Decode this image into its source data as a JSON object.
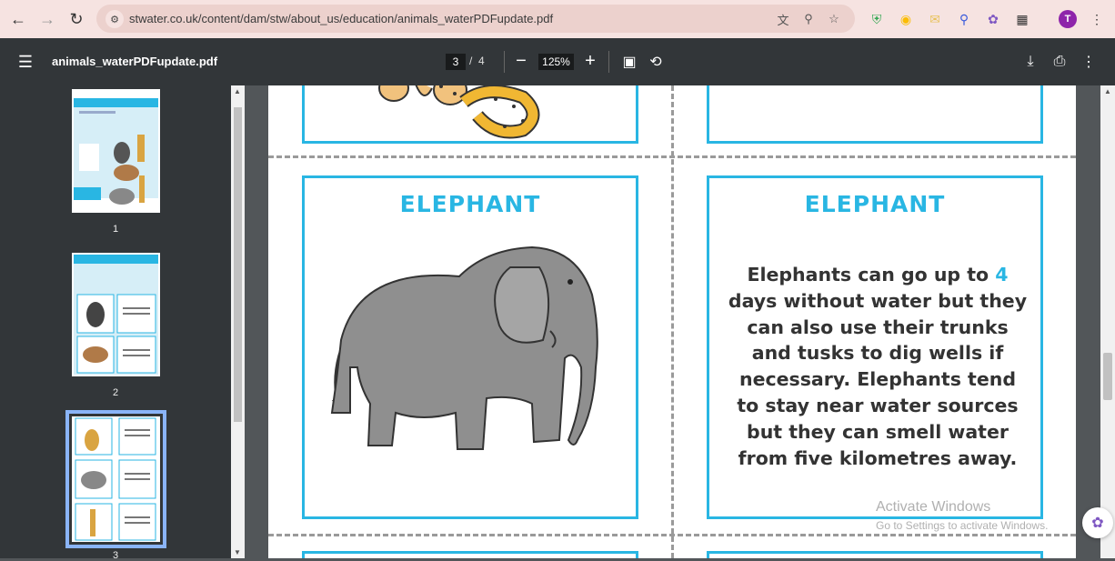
{
  "browser": {
    "url": "stwater.co.uk/content/dam/stw/about_us/education/animals_waterPDFupdate.pdf",
    "profile_initial": "T"
  },
  "toolbar": {
    "file_title": "animals_waterPDFupdate.pdf",
    "current_page": "3",
    "page_separator": "/",
    "total_pages": "4",
    "zoom": "125%"
  },
  "sidebar": {
    "thumbnails": [
      {
        "label": "1"
      },
      {
        "label": "2"
      },
      {
        "label": "3"
      }
    ],
    "selected_page": 3
  },
  "page": {
    "left_card_title": "ELEPHANT",
    "right_card_title": "ELEPHANT",
    "fact_before": "Elephants can go up to ",
    "fact_number": "4",
    "fact_after": " days without water but they can also use their trunks and tusks to dig wells if necessary. Elephants tend to stay near water sources but they can smell water from five kilometres away."
  },
  "watermark": {
    "line1": "Activate Windows",
    "line2": "Go to Settings to activate Windows."
  },
  "colors": {
    "accent": "#29b6e3",
    "toolbar_bg": "#323639",
    "browser_bg": "#f6e3e1"
  }
}
